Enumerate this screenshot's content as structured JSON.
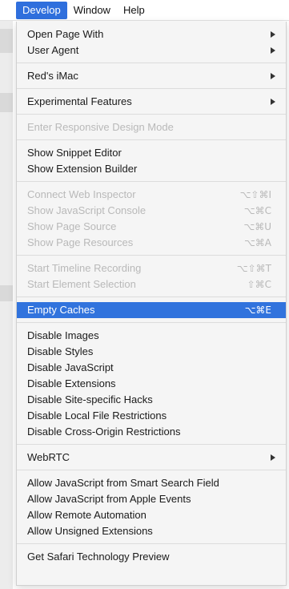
{
  "menubar": {
    "items": [
      "Develop",
      "Window",
      "Help"
    ]
  },
  "menu": {
    "groups": [
      [
        {
          "label": "Open Page With",
          "submenu": true
        },
        {
          "label": "User Agent",
          "submenu": true
        }
      ],
      [
        {
          "label": "Red's iMac",
          "submenu": true
        }
      ],
      [
        {
          "label": "Experimental Features",
          "submenu": true
        }
      ],
      [
        {
          "label": "Enter Responsive Design Mode",
          "disabled": true
        }
      ],
      [
        {
          "label": "Show Snippet Editor"
        },
        {
          "label": "Show Extension Builder"
        }
      ],
      [
        {
          "label": "Connect Web Inspector",
          "disabled": true,
          "shortcut": "⌥⇧⌘I"
        },
        {
          "label": "Show JavaScript Console",
          "disabled": true,
          "shortcut": "⌥⌘C"
        },
        {
          "label": "Show Page Source",
          "disabled": true,
          "shortcut": "⌥⌘U"
        },
        {
          "label": "Show Page Resources",
          "disabled": true,
          "shortcut": "⌥⌘A"
        }
      ],
      [
        {
          "label": "Start Timeline Recording",
          "disabled": true,
          "shortcut": "⌥⇧⌘T"
        },
        {
          "label": "Start Element Selection",
          "disabled": true,
          "shortcut": "⇧⌘C"
        }
      ],
      [
        {
          "label": "Empty Caches",
          "shortcut": "⌥⌘E",
          "highlighted": true
        }
      ],
      [
        {
          "label": "Disable Images"
        },
        {
          "label": "Disable Styles"
        },
        {
          "label": "Disable JavaScript"
        },
        {
          "label": "Disable Extensions"
        },
        {
          "label": "Disable Site-specific Hacks"
        },
        {
          "label": "Disable Local File Restrictions"
        },
        {
          "label": "Disable Cross-Origin Restrictions"
        }
      ],
      [
        {
          "label": "WebRTC",
          "submenu": true
        }
      ],
      [
        {
          "label": "Allow JavaScript from Smart Search Field"
        },
        {
          "label": "Allow JavaScript from Apple Events"
        },
        {
          "label": "Allow Remote Automation"
        },
        {
          "label": "Allow Unsigned Extensions"
        }
      ],
      [
        {
          "label": "Get Safari Technology Preview"
        }
      ]
    ]
  },
  "colors": {
    "highlight": "#3173dd",
    "disabled_text": "#b9b9b9",
    "menu_background": "#f5f5f5"
  }
}
